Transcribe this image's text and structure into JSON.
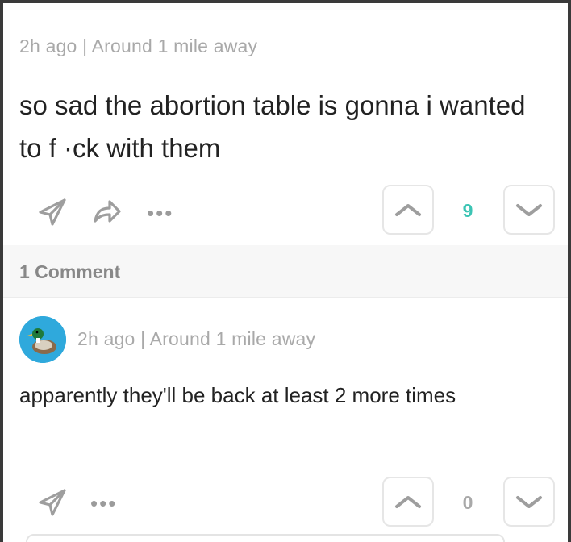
{
  "post": {
    "meta": "2h ago | Around 1 mile away",
    "body": "so sad the abortion table is gonna i wanted to f ·ck with them",
    "vote_count": "9",
    "vote_color": "#3cc4b4",
    "icons": {
      "share": "send-icon",
      "reply": "reply-arrow-icon",
      "more": "more-dots-icon",
      "up": "chevron-up-icon",
      "down": "chevron-down-icon"
    },
    "more_label": "•••"
  },
  "comments_header": {
    "label": "1 Comment"
  },
  "comment": {
    "meta": "2h ago | Around 1 mile away",
    "body": "apparently they'll be back at least 2 more times",
    "vote_count": "0",
    "vote_color": "#a9a9a9",
    "avatar_icon": "duck-avatar-icon",
    "avatar_color": "#2fa9dc",
    "more_label": "•••"
  }
}
